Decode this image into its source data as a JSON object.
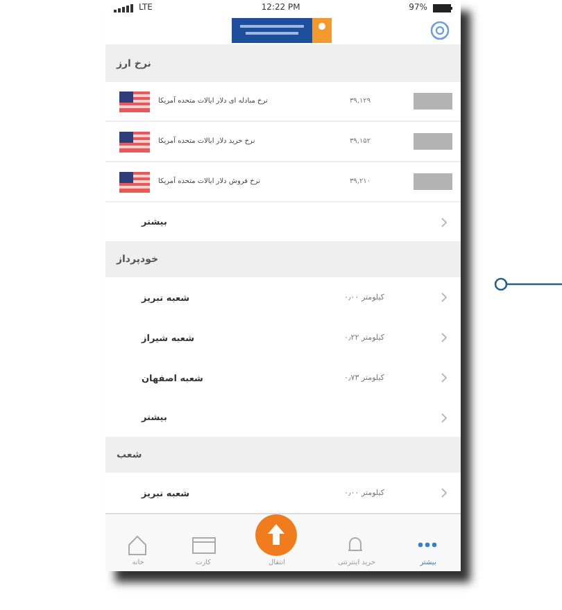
{
  "status_bar": {
    "network": "LTE",
    "time": "12:22 PM",
    "battery": "97%"
  },
  "sections": [
    {
      "title": "نرخ ارز",
      "kind": "rates",
      "rows": [
        {
          "label": "نرخ مبادله ای دلار ایالات متحده آمریکا",
          "value": "۳۹,۱۲۹"
        },
        {
          "label": "نرخ خرید دلار ایالات متحده آمریکا",
          "value": "۳۹,۱۵۲"
        },
        {
          "label": "نرخ فروش دلار ایالات متحده آمریکا",
          "value": "۳۹,۲۱۰"
        }
      ],
      "more": "بیشتر"
    },
    {
      "title": "خودپرداز",
      "kind": "places",
      "rows": [
        {
          "label": "شعبه تبریز",
          "value": "۰٫۰۰ کیلومتر"
        },
        {
          "label": "شعبه شیراز",
          "value": "۰٫۲۲ کیلومتر"
        },
        {
          "label": "شعبه اصفهان",
          "value": "۰٫۷۳ کیلومتر"
        }
      ],
      "more": "بیشتر"
    },
    {
      "title": "شعب",
      "kind": "places",
      "rows": [
        {
          "label": "شعبه تبریز",
          "value": "۰٫۰۰ کیلومتر"
        }
      ]
    }
  ],
  "tabs": [
    {
      "label": "بیشتر",
      "kind": "more",
      "selected": true
    },
    {
      "label": "خرید اینترنتی",
      "kind": "bell",
      "selected": false
    },
    {
      "label": "انتقال",
      "kind": "transfer",
      "selected": false
    },
    {
      "label": "کارت",
      "kind": "card",
      "selected": false
    },
    {
      "label": "خانه",
      "kind": "home",
      "selected": false
    }
  ]
}
